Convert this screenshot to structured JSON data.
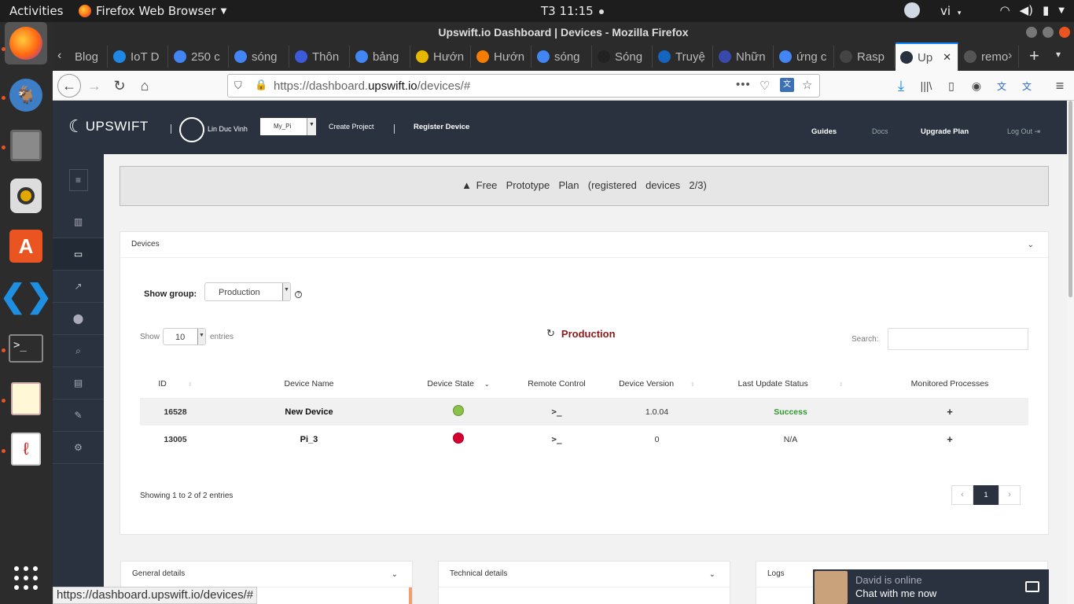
{
  "topbar": {
    "activities": "Activities",
    "app": "Firefox Web Browser",
    "clock": "T3 11:15",
    "lang": "vi"
  },
  "window": {
    "title": "Upswift.io Dashboard | Devices - Mozilla Firefox"
  },
  "tabs": [
    {
      "label": "Blog",
      "color": "#555"
    },
    {
      "label": "IoT D",
      "color": "#1e88e5"
    },
    {
      "label": "250 c",
      "color": "#4285f4"
    },
    {
      "label": "sóng",
      "color": "#4285f4"
    },
    {
      "label": "Thôn",
      "color": "#3b5bdb"
    },
    {
      "label": "bảng",
      "color": "#4285f4"
    },
    {
      "label": "Hướn",
      "color": "#e6b800"
    },
    {
      "label": "Hướn",
      "color": "#f57c00"
    },
    {
      "label": "sóng",
      "color": "#4285f4"
    },
    {
      "label": "Sóng",
      "color": "#222"
    },
    {
      "label": "Truyệ",
      "color": "#1565c0"
    },
    {
      "label": "Nhữn",
      "color": "#3949ab"
    },
    {
      "label": "ứng c",
      "color": "#4285f4"
    },
    {
      "label": "Rasp",
      "color": "#444"
    },
    {
      "label": "Up",
      "color": "#2a3240"
    },
    {
      "label": "remo",
      "color": "#555"
    }
  ],
  "url": {
    "prefix": "https://dashboard.",
    "domain": "upswift.io",
    "path": "/devices/#"
  },
  "status_url": "https://dashboard.upswift.io/devices/#",
  "header": {
    "brand": "UPSWIFT",
    "user": "Lin Duc Vinh",
    "project_select": "My_Pi",
    "create_project": "Create Project",
    "register_device": "Register Device",
    "guides": "Guides",
    "docs": "Docs",
    "upgrade": "Upgrade Plan",
    "logout": "Log Out"
  },
  "banner": "Free  Prototype  Plan  (registered  devices  2/3)",
  "devices_panel": {
    "title": "Devices",
    "show_group_label": "Show group:",
    "group_value": "Production",
    "show_label": "Show",
    "entries_value": "10",
    "entries_label": "entries",
    "group_title": "Production",
    "search_label": "Search:",
    "columns": [
      "ID",
      "Device Name",
      "Device State",
      "Remote Control",
      "Device Version",
      "Last Update Status",
      "Monitored Processes"
    ],
    "rows": [
      {
        "id": "16528",
        "name": "New Device",
        "state_color": "#8bc34a",
        "remote": ">_",
        "version": "1.0.04",
        "status": "Success",
        "status_color": "#2e9a2e",
        "processes": "+"
      },
      {
        "id": "13005",
        "name": "Pi_3",
        "state_color": "#d50032",
        "remote": ">_",
        "version": "0",
        "status": "N/A",
        "status_color": "#333",
        "processes": "+"
      }
    ],
    "showing": "Showing 1 to 2 of 2 entries",
    "pagination": {
      "prev": "‹",
      "page": "1",
      "next": "›"
    }
  },
  "bottom_panels": [
    {
      "title": "General details"
    },
    {
      "title": "Technical details"
    },
    {
      "title": "Logs"
    }
  ],
  "chat": {
    "line1": "David is online",
    "line2": "Chat with me now"
  }
}
